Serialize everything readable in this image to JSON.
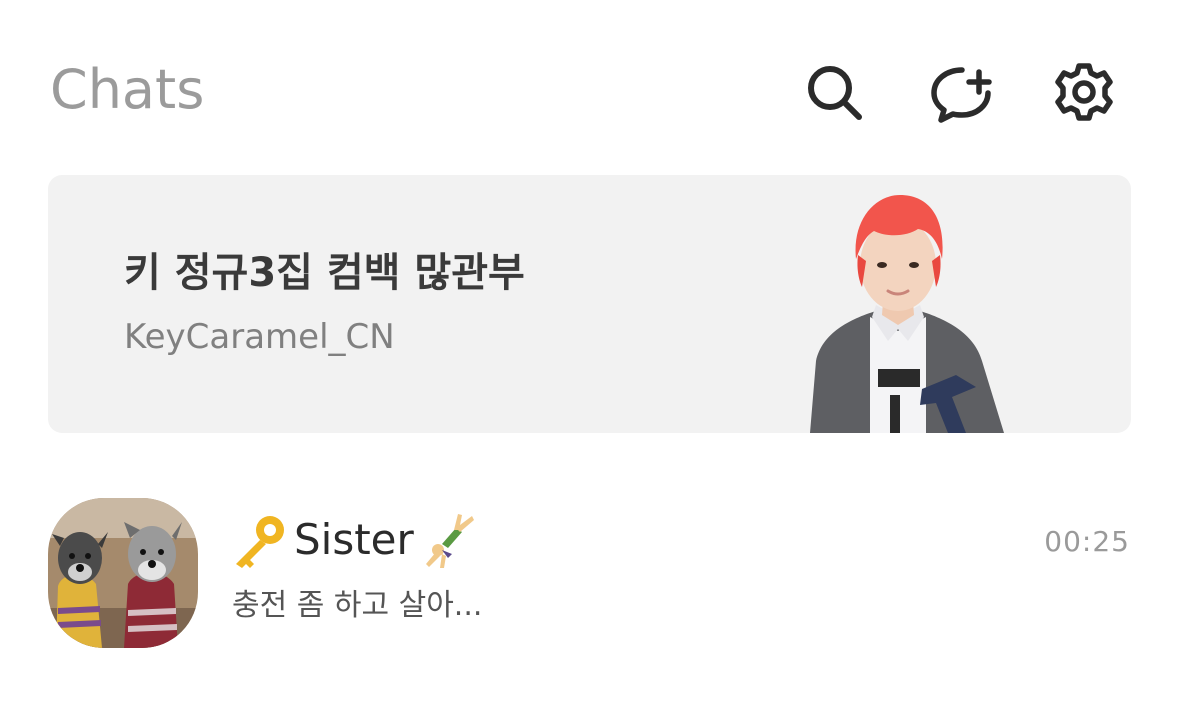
{
  "header": {
    "title": "Chats",
    "icons": [
      "search-icon",
      "new-chat-icon",
      "settings-icon"
    ]
  },
  "banner": {
    "title": "키 정규3집 컴백 많관부",
    "subtitle": "KeyCaramel_CN"
  },
  "chats": [
    {
      "name": "Sister",
      "name_prefix_icon": "key-emoji",
      "name_suffix_icon": "cartwheel-emoji",
      "time": "00:25",
      "preview": "충전 좀 하고 살아..."
    }
  ],
  "colors": {
    "background": "#ffffff",
    "title": "#9b9b9b",
    "icon": "#2b2b2b",
    "banner_bg": "#f2f2f2",
    "time": "#9a9a9a"
  }
}
